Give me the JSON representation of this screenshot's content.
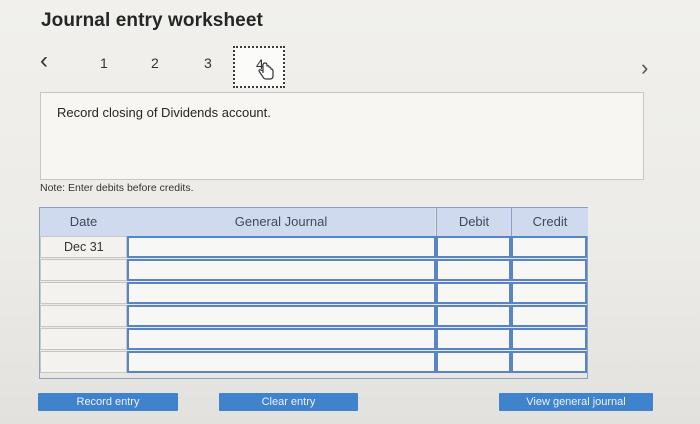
{
  "title": "Journal entry worksheet",
  "nav": {
    "prev_glyph": "‹",
    "next_glyph": "›",
    "steps": [
      "1",
      "2",
      "3",
      "4"
    ],
    "active_step": "4"
  },
  "instruction": "Record closing of Dividends account.",
  "note": "Note: Enter debits before credits.",
  "journal": {
    "headers": {
      "date": "Date",
      "general_journal": "General Journal",
      "debit": "Debit",
      "credit": "Credit"
    },
    "rows": [
      {
        "date": "Dec 31",
        "account": "",
        "debit": "",
        "credit": ""
      },
      {
        "date": "",
        "account": "",
        "debit": "",
        "credit": ""
      },
      {
        "date": "",
        "account": "",
        "debit": "",
        "credit": ""
      },
      {
        "date": "",
        "account": "",
        "debit": "",
        "credit": ""
      },
      {
        "date": "",
        "account": "",
        "debit": "",
        "credit": ""
      },
      {
        "date": "",
        "account": "",
        "debit": "",
        "credit": ""
      }
    ]
  },
  "buttons": {
    "record": "Record entry",
    "clear": "Clear entry",
    "view": "View general journal"
  },
  "colors": {
    "accent": "#3f83cd",
    "header_bg": "#cfdaee",
    "input_border": "#5a84c8"
  }
}
